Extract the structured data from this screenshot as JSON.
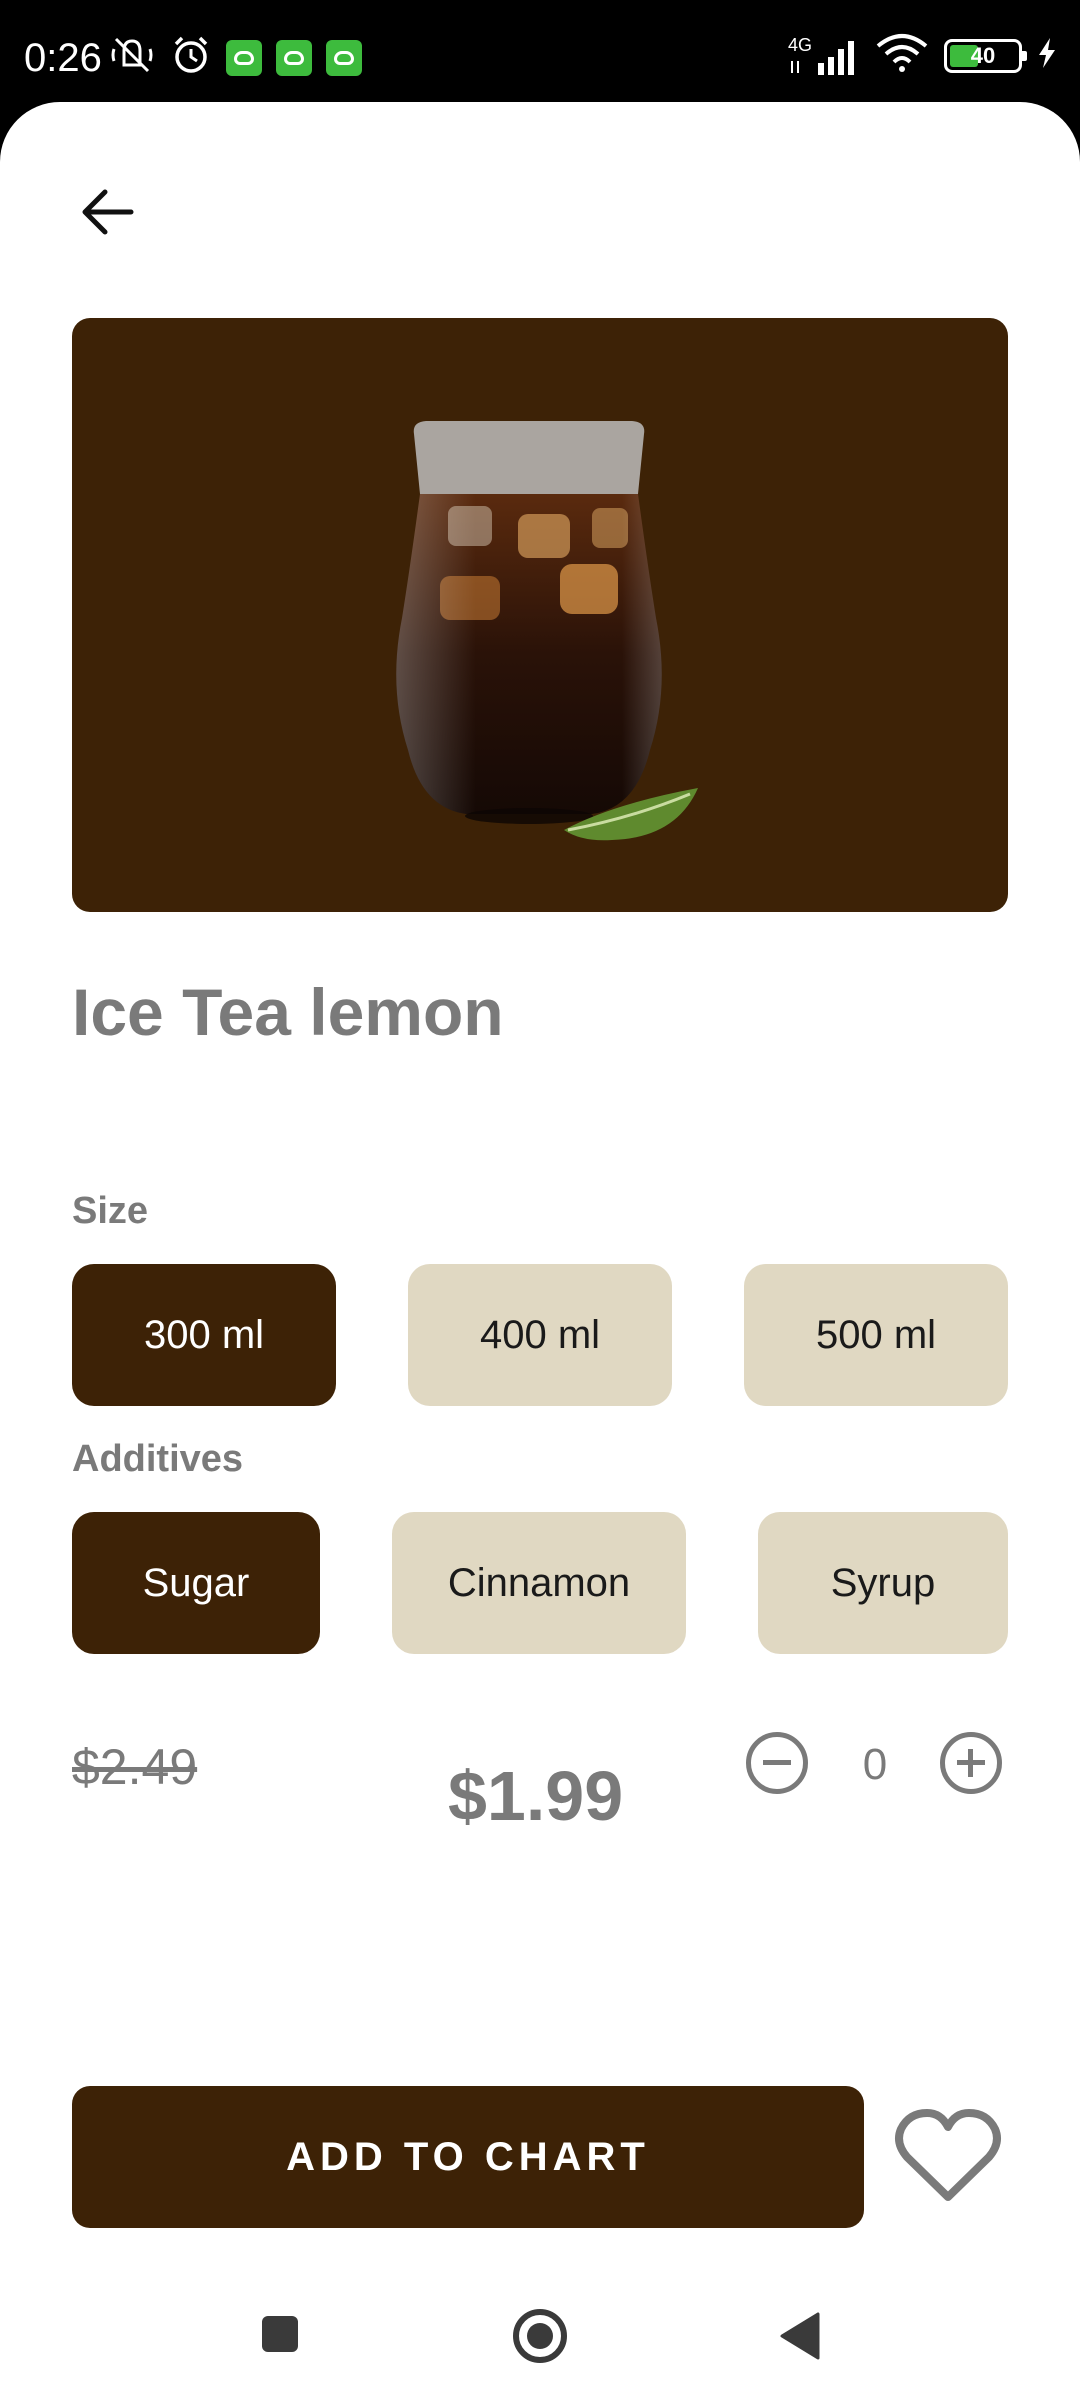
{
  "status_bar": {
    "time": "0:26",
    "network": "4G",
    "battery": "40",
    "icons_left": [
      "mute-icon",
      "alarm-icon",
      "app-badge-icon",
      "app-badge-icon",
      "app-badge-icon"
    ],
    "icons_right": [
      "signal-icon",
      "wifi-icon",
      "battery-icon",
      "charging-icon"
    ]
  },
  "product": {
    "title": "Ice Tea lemon",
    "image": "iced-tea-glass-with-mint"
  },
  "size": {
    "label": "Size",
    "options": [
      "300 ml",
      "400 ml",
      "500 ml"
    ],
    "selected": "300 ml"
  },
  "additives": {
    "label": "Additives",
    "options": [
      "Sugar",
      "Cinnamon",
      "Syrup"
    ],
    "selected": "Sugar"
  },
  "pricing": {
    "old_price": "$2.49",
    "price": "$1.99",
    "quantity": "0"
  },
  "actions": {
    "add_label": "ADD TO CHART"
  },
  "colors": {
    "brand": "#3d2206",
    "chip_inactive": "#e0d8c2",
    "text_muted": "#7a7a7a"
  }
}
